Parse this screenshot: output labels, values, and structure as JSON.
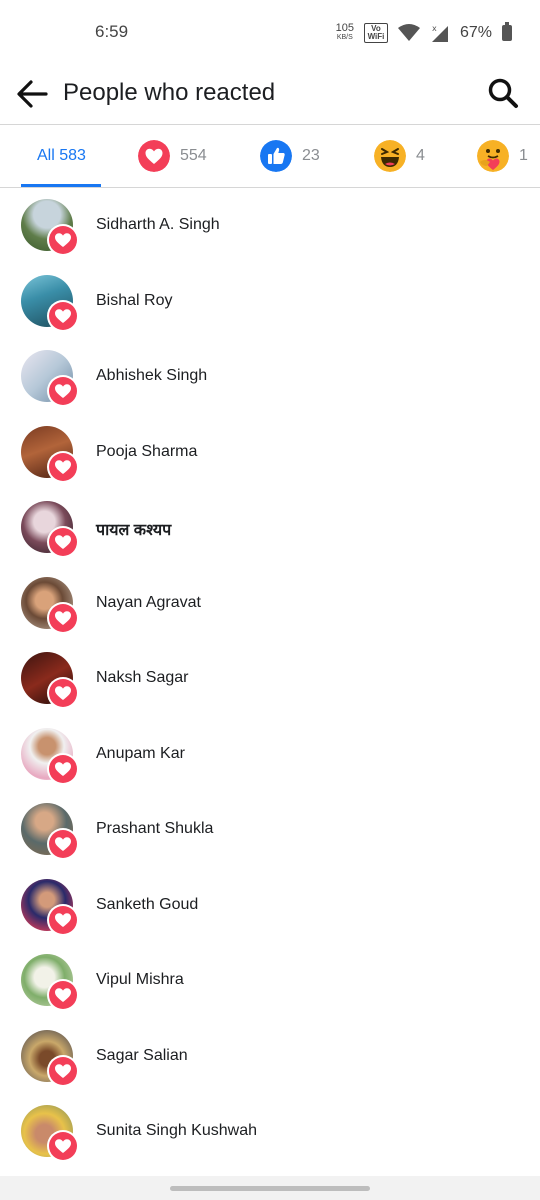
{
  "status": {
    "time": "6:59",
    "speed_value": "105",
    "speed_unit": "KB/S",
    "volte_line1": "Vo",
    "volte_line2": "WiFi",
    "battery": "67%"
  },
  "header": {
    "title": "People who reacted",
    "back_icon": "back-arrow-icon",
    "search_icon": "search-icon"
  },
  "tabs": [
    {
      "label": "All 583",
      "icon": null
    },
    {
      "count": "554",
      "icon": "love-reaction-icon",
      "color": "#f33e58"
    },
    {
      "count": "23",
      "icon": "like-reaction-icon",
      "color": "#1877f2"
    },
    {
      "count": "4",
      "icon": "haha-reaction-icon",
      "color": "#f7b125"
    },
    {
      "count": "1",
      "icon": "care-reaction-icon",
      "color": "#f7b125"
    }
  ],
  "colors": {
    "accent": "#1877f2",
    "love": "#f33e58"
  },
  "people": [
    {
      "name": "Sidharth A. Singh",
      "reaction": "love"
    },
    {
      "name": "Bishal Roy",
      "reaction": "love"
    },
    {
      "name": "Abhishek Singh",
      "reaction": "love"
    },
    {
      "name": "Pooja Sharma",
      "reaction": "love"
    },
    {
      "name": "पायल कश्यप",
      "reaction": "love"
    },
    {
      "name": "Nayan Agravat",
      "reaction": "love"
    },
    {
      "name": "Naksh Sagar",
      "reaction": "love"
    },
    {
      "name": "Anupam Kar",
      "reaction": "love"
    },
    {
      "name": "Prashant Shukla",
      "reaction": "love"
    },
    {
      "name": "Sanketh Goud",
      "reaction": "love"
    },
    {
      "name": "Vipul Mishra",
      "reaction": "love"
    },
    {
      "name": "Sagar Salian",
      "reaction": "love"
    },
    {
      "name": "Sunita Singh Kushwah",
      "reaction": "love"
    }
  ]
}
